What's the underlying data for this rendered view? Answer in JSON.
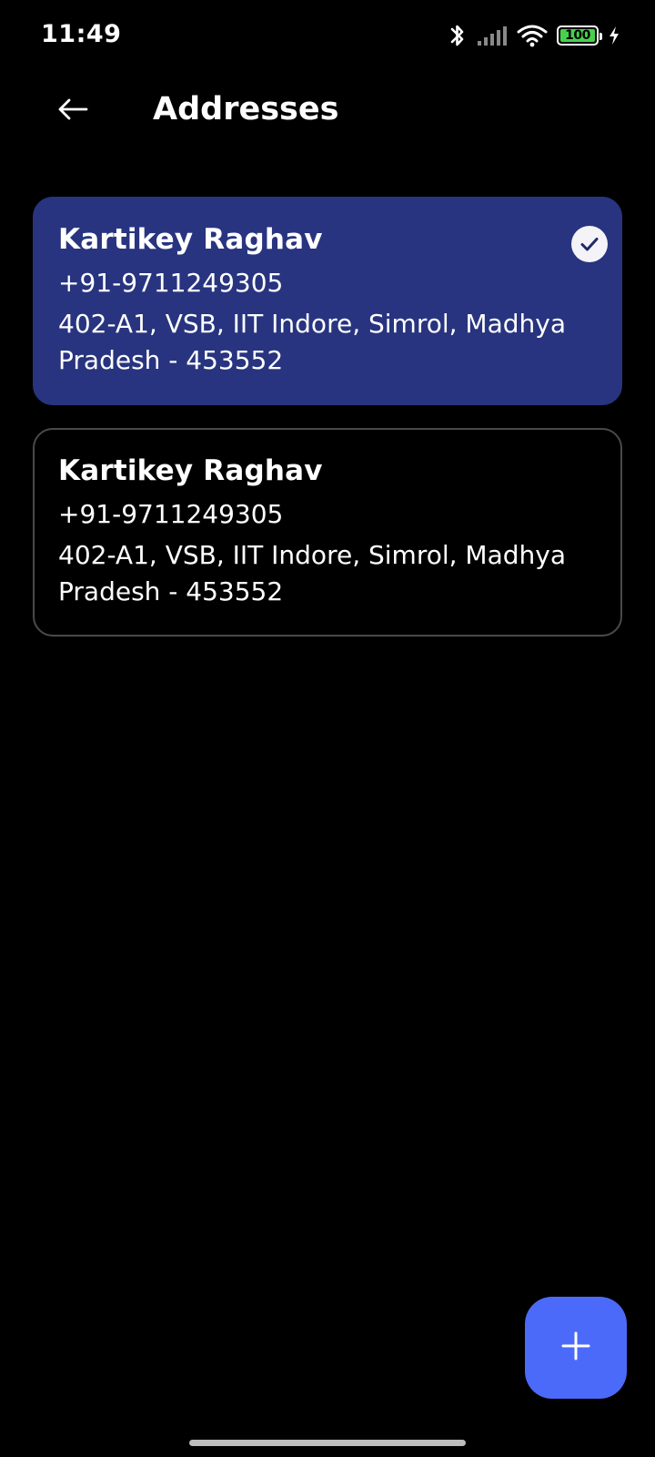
{
  "status_bar": {
    "time": "11:49",
    "battery_level": "100",
    "battery_fraction": 1.0,
    "icons": [
      "bluetooth-icon",
      "signal-icon",
      "wifi-icon",
      "battery-icon",
      "charging-icon"
    ],
    "battery_color": "#47d14c"
  },
  "app_bar": {
    "back_icon": "arrow-left-icon",
    "title": "Addresses"
  },
  "addresses": [
    {
      "name": "Kartikey Raghav",
      "phone": "+91-9711249305",
      "address": "402-A1, VSB, IIT Indore, Simrol, Madhya Pradesh - 453552",
      "selected": true
    },
    {
      "name": "Kartikey Raghav",
      "phone": "+91-9711249305",
      "address": "402-A1, VSB, IIT Indore, Simrol, Madhya Pradesh - 453552",
      "selected": false
    }
  ],
  "fab": {
    "icon": "plus-icon"
  },
  "colors": {
    "background": "#000000",
    "selected_card": "#28347f",
    "unselected_border": "#4a4a4a",
    "fab": "#4c6af9",
    "check_badge": "#f4f4f8"
  }
}
